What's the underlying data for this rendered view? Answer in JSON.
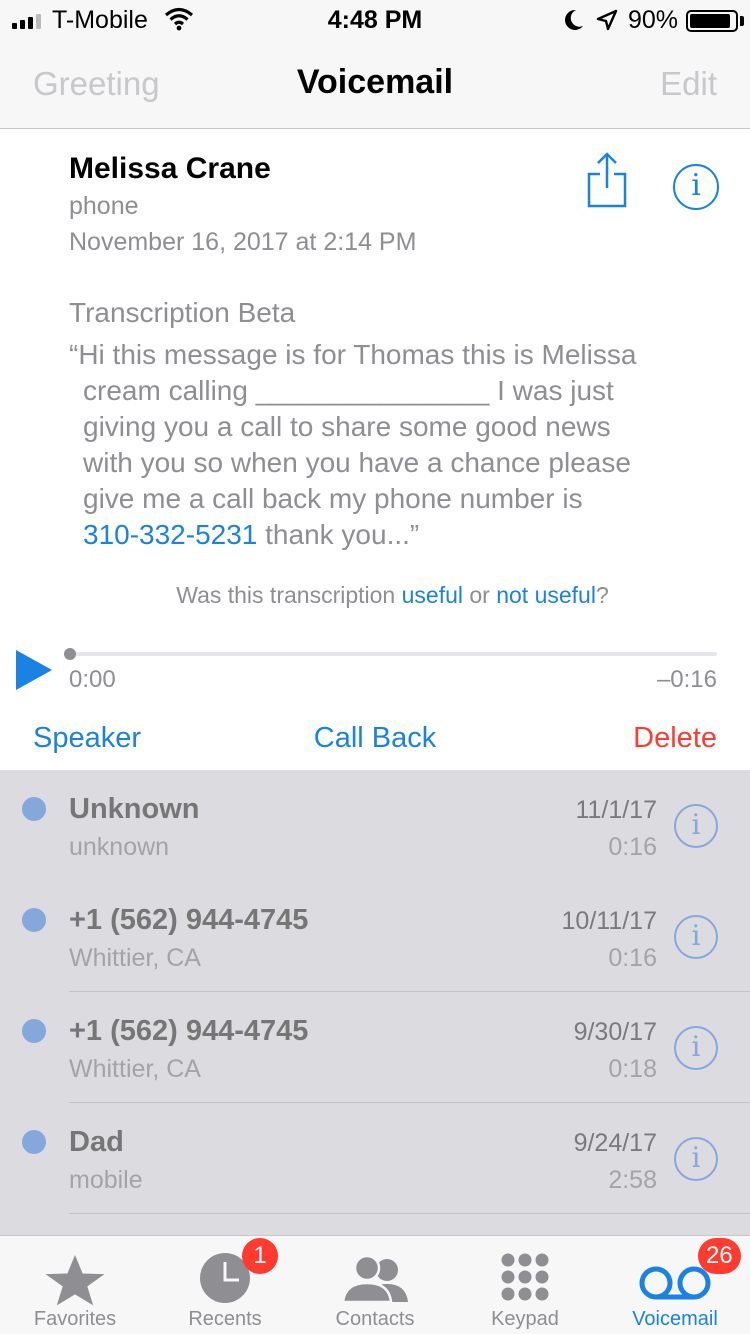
{
  "status_bar": {
    "carrier": "T-Mobile",
    "time": "4:48 PM",
    "battery_percent": "90%",
    "battery_level": 0.9,
    "icons": [
      "signal-icon",
      "wifi-icon",
      "moon-icon",
      "location-icon",
      "battery-icon"
    ]
  },
  "nav": {
    "left": "Greeting",
    "title": "Voicemail",
    "right": "Edit"
  },
  "detail": {
    "name": "Melissa Crane",
    "type": "phone",
    "date": "November 16, 2017 at 2:14 PM",
    "transcription_header": "Transcription Beta",
    "transcription_lines": [
      "“Hi this message is for Thomas this is Melissa",
      "cream calling _______________ I was just",
      "giving you a call to share some good news",
      "with you so when you have a chance please",
      "give me a call back my phone number is"
    ],
    "transcription_phone": "310-332-5231",
    "transcription_end": " thank you...”",
    "feedback_prefix": "Was this transcription ",
    "feedback_useful": "useful",
    "feedback_or": " or ",
    "feedback_not_useful": "not useful",
    "feedback_suffix": "?",
    "elapsed": "0:00",
    "remaining": "–0:16",
    "progress": 0,
    "speaker_label": "Speaker",
    "callback_label": "Call Back",
    "delete_label": "Delete"
  },
  "voicemails": [
    {
      "name": "Unknown",
      "sub": "unknown",
      "date": "11/1/17",
      "duration": "0:16"
    },
    {
      "name": "+1 (562) 944-4745",
      "sub": "Whittier, CA",
      "date": "10/11/17",
      "duration": "0:16"
    },
    {
      "name": "+1 (562) 944-4745",
      "sub": "Whittier, CA",
      "date": "9/30/17",
      "duration": "0:18"
    },
    {
      "name": "Dad",
      "sub": "mobile",
      "date": "9/24/17",
      "duration": "2:58"
    }
  ],
  "tabs": [
    {
      "label": "Favorites",
      "icon": "star-icon",
      "badge": ""
    },
    {
      "label": "Recents",
      "icon": "clock-icon",
      "badge": "1"
    },
    {
      "label": "Contacts",
      "icon": "contacts-icon",
      "badge": ""
    },
    {
      "label": "Keypad",
      "icon": "keypad-icon",
      "badge": ""
    },
    {
      "label": "Voicemail",
      "icon": "voicemail-icon",
      "badge": "26",
      "active": true
    }
  ],
  "colors": {
    "accent": "#1a82e2",
    "delete": "#ff3b30",
    "badge": "#ff3b30",
    "unread_dot": "#84a7dc"
  }
}
